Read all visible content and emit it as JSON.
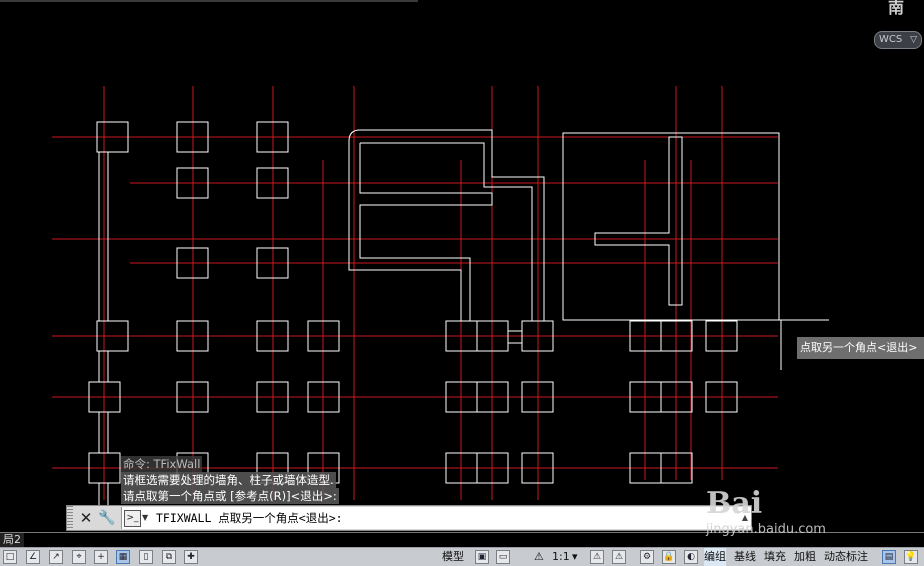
{
  "viewport": {
    "compass_label": "南",
    "ucs_menu_label": "WCS",
    "ucs_menu_chevron": "chevron-down-icon"
  },
  "dynamic_tooltip": "点取另一个角点<退出>",
  "command_history": [
    "命令: TFixWall",
    "请框选需要处理的墙角、柱子或墙体造型.",
    "请点取第一个角点或 [参考点(R)]<退出>:"
  ],
  "command_line": {
    "close_icon": "close-icon",
    "customize_icon": "wrench-icon",
    "prompt_icon": "command-prompt-icon",
    "text": "TFIXWALL 点取另一个角点<退出>:"
  },
  "layout_tab": "局2",
  "status_bar": {
    "model_label": "模型",
    "annotation_scale": "1:1",
    "items": [
      "编组",
      "基线",
      "填充",
      "加粗",
      "动态标注"
    ]
  },
  "watermark": {
    "logo": "Bai",
    "url": "jingyan.baidu.com"
  },
  "colors": {
    "axis_line": "#c8191e",
    "wall_line": "#ffffff",
    "background": "#000000"
  }
}
